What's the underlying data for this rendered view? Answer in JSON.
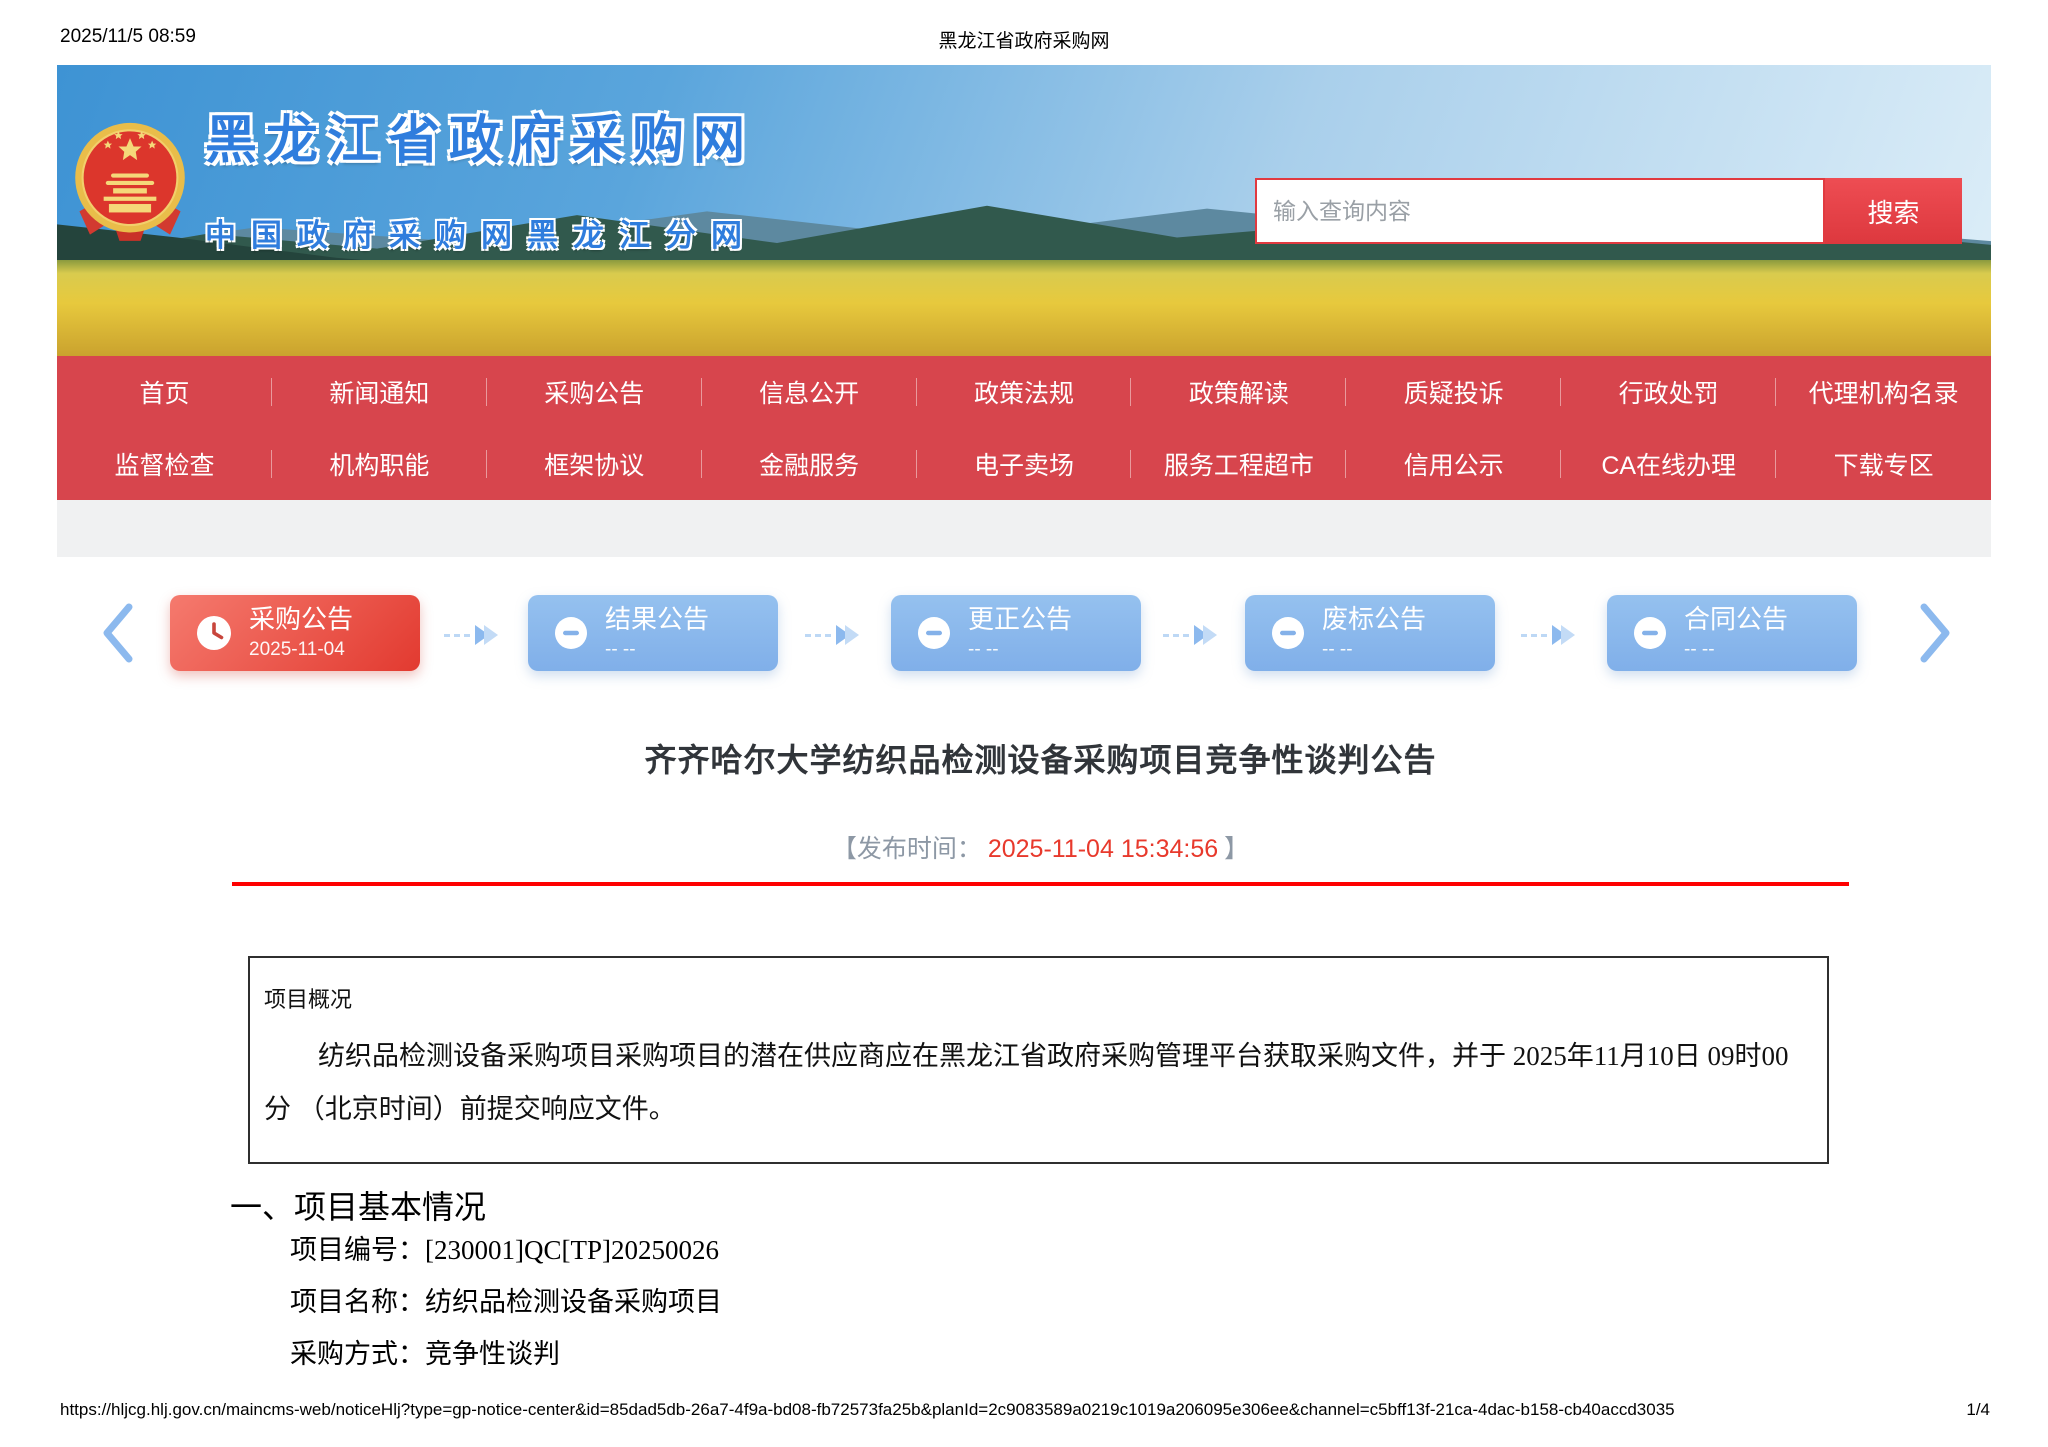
{
  "page": {
    "print_datetime": "2025/11/5 08:59",
    "print_title": "黑龙江省政府采购网",
    "footer_url": "https://hljcg.hlj.gov.cn/maincms-web/noticeHlj?type=gp-notice-center&id=85dad5db-26a7-4f9a-bd08-fb72573fa25b&planId=2c9083589a0219c1019a206095e306ee&channel=c5bff13f-21ca-4dac-b158-cb40accd3035",
    "footer_page": "1/4"
  },
  "banner": {
    "site_title": "黑龙江省政府采购网",
    "site_subtitle": "中国政府采购网黑龙江分网",
    "search_placeholder": "输入查询内容",
    "search_button": "搜索"
  },
  "nav": {
    "row1": [
      "首页",
      "新闻通知",
      "采购公告",
      "信息公开",
      "政策法规",
      "政策解读",
      "质疑投诉",
      "行政处罚",
      "代理机构名录"
    ],
    "row2": [
      "监督检查",
      "机构职能",
      "框架协议",
      "金融服务",
      "电子卖场",
      "服务工程超市",
      "信用公示",
      "CA在线办理",
      "下载专区"
    ]
  },
  "timeline": {
    "cards": [
      {
        "label": "采购公告",
        "date": "2025-11-04"
      },
      {
        "label": "结果公告",
        "date": "-- --"
      },
      {
        "label": "更正公告",
        "date": "-- --"
      },
      {
        "label": "废标公告",
        "date": "-- --"
      },
      {
        "label": "合同公告",
        "date": "-- --"
      }
    ]
  },
  "article": {
    "title": "齐齐哈尔大学纺织品检测设备采购项目竞争性谈判公告",
    "publish_prefix": "【发布时间：",
    "publish_time": "2025-11-04 15:34:56",
    "publish_suffix": "】",
    "overview_heading": "项目概况",
    "overview_text": "纺织品检测设备采购项目采购项目的潜在供应商应在黑龙江省政府采购管理平台获取采购文件，并于 2025年11月10日 09时00分 （北京时间）前提交响应文件。",
    "section_heading": "一、项目基本情况",
    "fields": [
      {
        "label": "项目编号：",
        "value": "[230001]QC[TP]20250026"
      },
      {
        "label": "项目名称：",
        "value": "纺织品检测设备采购项目"
      },
      {
        "label": "采购方式：",
        "value": "竞争性谈判"
      }
    ]
  },
  "colors": {
    "nav_red": "#d7454d",
    "card_active_red": "#e23a30",
    "card_blue": "#8ab7ec",
    "divider_red": "#fe0000",
    "publish_time_red": "#e8392c",
    "site_title_blue": "#2f7ddd"
  }
}
